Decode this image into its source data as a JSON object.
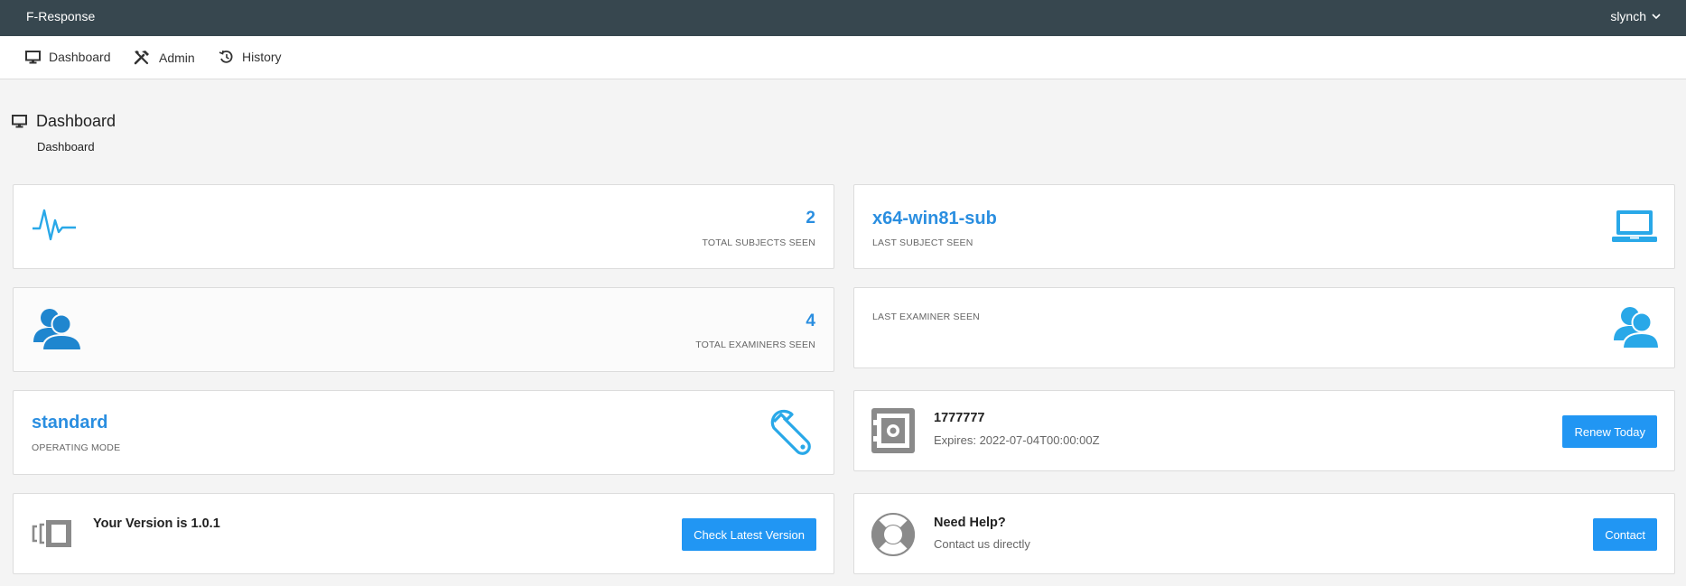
{
  "topbar": {
    "brand": "F-Response",
    "user": "slynch"
  },
  "nav": {
    "dashboard": "Dashboard",
    "admin": "Admin",
    "history": "History"
  },
  "page": {
    "title": "Dashboard",
    "breadcrumb": "Dashboard"
  },
  "cards": {
    "subjects": {
      "value": "2",
      "label": "TOTAL SUBJECTS SEEN"
    },
    "last_subject": {
      "value": "x64-win81-sub",
      "label": "LAST SUBJECT SEEN"
    },
    "examiners": {
      "value": "4",
      "label": "TOTAL EXAMINERS SEEN"
    },
    "last_examiner": {
      "label": "LAST EXAMINER SEEN"
    },
    "mode": {
      "value": "standard",
      "label": "OPERATING MODE"
    },
    "license": {
      "number": "1777777",
      "expires": "Expires: 2022-07-04T00:00:00Z",
      "button": "Renew Today"
    },
    "version": {
      "text": "Your Version is 1.0.1",
      "button": "Check Latest Version"
    },
    "help": {
      "title": "Need Help?",
      "subtitle": "Contact us directly",
      "button": "Contact"
    }
  },
  "colors": {
    "topbar": "#37474f",
    "accent": "#2196f3",
    "icon_blue": "#29a8e8",
    "icon_grey": "#8a8a8a"
  },
  "icons": [
    "monitor-icon",
    "tools-icon",
    "history-icon",
    "pulse-icon",
    "laptop-icon",
    "users-icon",
    "wrench-icon",
    "safe-icon",
    "version-icon",
    "lifebuoy-icon",
    "chevron-down-icon"
  ]
}
